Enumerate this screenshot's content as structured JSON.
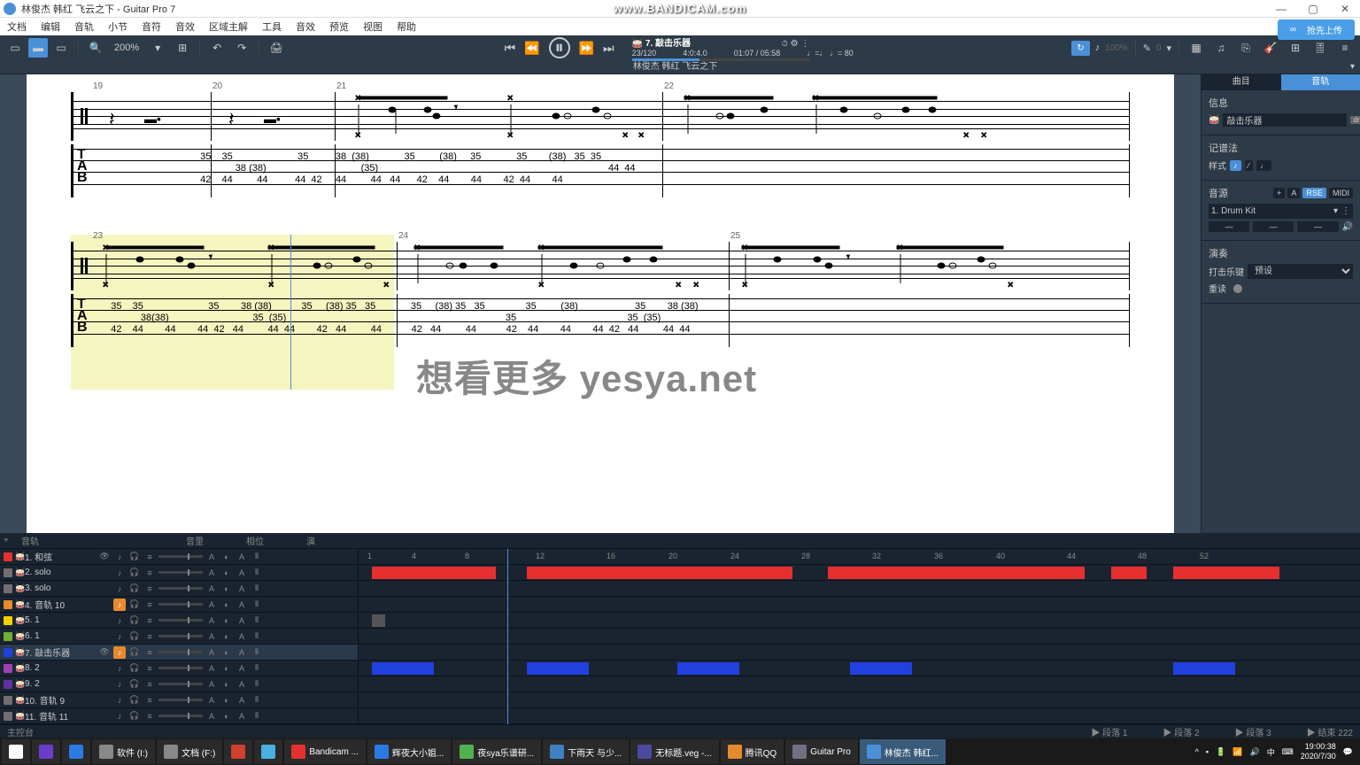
{
  "app": {
    "title": "林俊杰 韩红 飞云之下 - Guitar Pro 7"
  },
  "bandicam": "www.BANDICAM.com",
  "menu": [
    "文档",
    "编辑",
    "音轨",
    "小节",
    "音符",
    "音效",
    "区域主解",
    "工具",
    "音效",
    "预览",
    "视图",
    "帮助"
  ],
  "upload": "抢先上传",
  "toolbar": {
    "zoom": "200%"
  },
  "transport": {
    "track": "7. 敲击乐器",
    "position": "23/120",
    "timesig": "4:0:4.0",
    "time": "01:07 / 05:58",
    "tempo": "♩=♩  ♩= 80"
  },
  "song_header": "林俊杰 韩红 飞云之下",
  "side": {
    "tabs": [
      "曲目",
      "音轨"
    ],
    "info_title": "信息",
    "track_name": "敲击乐器",
    "abbr": "drm.",
    "notation_title": "记谱法",
    "style_label": "样式",
    "sound_title": "音源",
    "sound_name": "1. Drum Kit",
    "rse": "RSE",
    "midi": "MIDI",
    "perf_title": "演奏",
    "strike_label": "打击乐键",
    "strike_value": "预设",
    "repeat_label": "重读"
  },
  "tracks": {
    "header_plus": "+",
    "header_name": "音轨",
    "header_vol": "音里",
    "header_pan": "相位",
    "header_play": "演",
    "list": [
      {
        "n": "1",
        "name": "和弦",
        "color": "#e63030"
      },
      {
        "n": "2",
        "name": "solo",
        "color": "#707070"
      },
      {
        "n": "3",
        "name": "solo",
        "color": "#707070"
      },
      {
        "n": "4",
        "name": "音轨 10",
        "color": "#e68a2e"
      },
      {
        "n": "5",
        "name": "1",
        "color": "#f0d000"
      },
      {
        "n": "6",
        "name": "1",
        "color": "#70b030"
      },
      {
        "n": "7",
        "name": "敲击乐器",
        "color": "#2040e0"
      },
      {
        "n": "8",
        "name": "2",
        "color": "#a040b0"
      },
      {
        "n": "9",
        "name": "2",
        "color": "#6030a0"
      },
      {
        "n": "10",
        "name": "音轨 9",
        "color": "#707070"
      },
      {
        "n": "11",
        "name": "音轨 11",
        "color": "#707070"
      }
    ],
    "master": "主控台",
    "footer": [
      "段落 1",
      "段落 2",
      "段落 3",
      "结束 222"
    ]
  },
  "timeline_ticks": [
    "1",
    "4",
    "8",
    "12",
    "16",
    "20",
    "24",
    "28",
    "32",
    "36",
    "40",
    "44",
    "48",
    "52"
  ],
  "measures": {
    "row1": [
      "19",
      "20",
      "21",
      "22"
    ],
    "row2": [
      "23",
      "24",
      "25"
    ]
  },
  "tab_data": {
    "row1_line1": "                                     35    35                        35          38  (38)             35         (38)     35             35        (38)   35  35",
    "row1_line2": "                                                  38 (38)                                   (35)                                                                                     44  44",
    "row1_line3": "                                     42    44         44          44  42     44         44   44      42    44        44        42  44        44",
    "row2_line1": "    35    35                        35        38 (38)           35     (38) 35   35             35     (38) 35   35               35         (38)                     35        38 (38)",
    "row2_line2": "               38(38)                               35  (35)                                                                                 35                                         35  (35)",
    "row2_line3": "    42    44        44        44  42   44         44  44        42   44         44           42   44         44           42    44        44        44  42   44         44  44"
  },
  "taskbar": {
    "items": [
      {
        "label": "",
        "icon": "#fff"
      },
      {
        "label": "",
        "icon": "#6a3dc8"
      },
      {
        "label": "",
        "icon": "#2a7ae2"
      },
      {
        "label": "软件 (I:)",
        "icon": "#888"
      },
      {
        "label": "文档 (F:)",
        "icon": "#888"
      },
      {
        "label": "",
        "icon": "#d04030"
      },
      {
        "label": "",
        "icon": "#4ab0e0"
      },
      {
        "label": "Bandicam ...",
        "icon": "#e63030"
      },
      {
        "label": "辉夜大小姐...",
        "icon": "#2a7ae2"
      },
      {
        "label": "夜sya乐谱研...",
        "icon": "#50b050"
      },
      {
        "label": "下雨天 与少...",
        "icon": "#4080c0"
      },
      {
        "label": "无标题.veg -...",
        "icon": "#4a4aa0"
      },
      {
        "label": "腾讯QQ",
        "icon": "#e68a2e"
      },
      {
        "label": "Guitar Pro",
        "icon": "#707080"
      },
      {
        "label": "林俊杰 韩红...",
        "icon": "#4a90d9"
      }
    ],
    "time": "19:00:38",
    "date": "2020/7/30"
  }
}
